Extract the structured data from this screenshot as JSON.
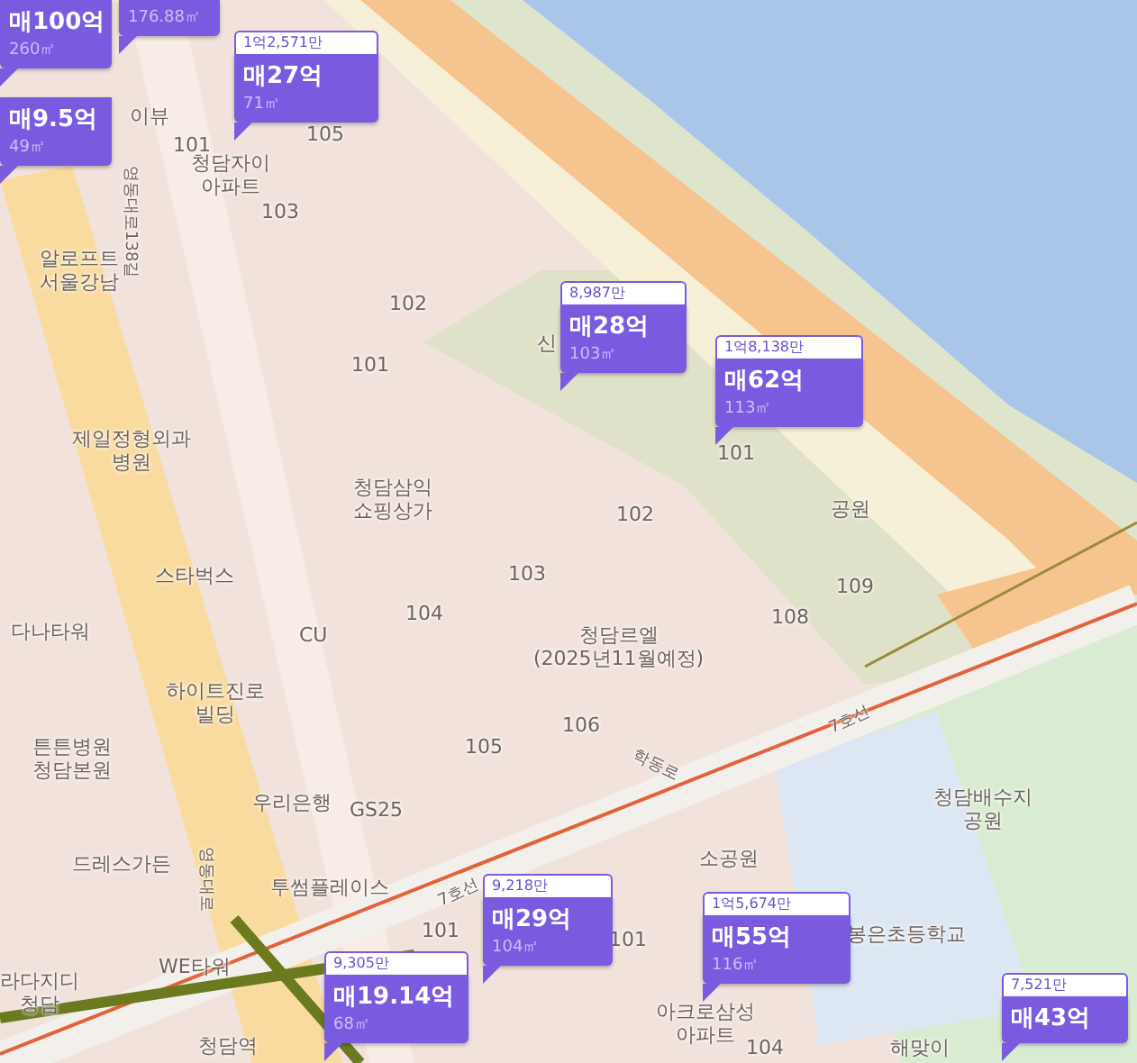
{
  "map": {
    "labels": [
      {
        "text": "이뷰"
      },
      {
        "text": "101"
      },
      {
        "text": "청담자이\n아파트"
      },
      {
        "text": "105"
      },
      {
        "text": "103"
      },
      {
        "text": "영동대로138길"
      },
      {
        "text": "알로프트\n서울강남"
      },
      {
        "text": "102"
      },
      {
        "text": "101"
      },
      {
        "text": "신"
      },
      {
        "text": "제일정형외과\n병원"
      },
      {
        "text": "청담삼익\n쇼핑상가"
      },
      {
        "text": "스타벅스"
      },
      {
        "text": "다나타워"
      },
      {
        "text": "CU"
      },
      {
        "text": "하이트진로\n빌딩"
      },
      {
        "text": "튼튼병원\n청담본원"
      },
      {
        "text": "우리은행"
      },
      {
        "text": "GS25"
      },
      {
        "text": "드레스가든"
      },
      {
        "text": "투썸플레이스"
      },
      {
        "text": "104"
      },
      {
        "text": "103"
      },
      {
        "text": "102"
      },
      {
        "text": "101"
      },
      {
        "text": "105"
      },
      {
        "text": "106"
      },
      {
        "text": "청담르엘\n(2025년11월예정)"
      },
      {
        "text": "108"
      },
      {
        "text": "공원"
      },
      {
        "text": "109"
      },
      {
        "text": "7호선"
      },
      {
        "text": "학동로"
      },
      {
        "text": "청담배수지\n공원"
      },
      {
        "text": "소공원"
      },
      {
        "text": "7호선"
      },
      {
        "text": "101"
      },
      {
        "text": "101"
      },
      {
        "text": "봉은초등학교"
      },
      {
        "text": "WE타워"
      },
      {
        "text": "라다지디\n청담"
      },
      {
        "text": "청담역"
      },
      {
        "text": "아크로삼성\n아파트"
      },
      {
        "text": "104"
      },
      {
        "text": "해맞이"
      },
      {
        "text": "영동대로"
      }
    ]
  },
  "markers": [
    {
      "price": "매100억",
      "area": "260㎡"
    },
    {
      "price": "매9.5억",
      "area": "49㎡"
    },
    {
      "area": "176.88㎡"
    },
    {
      "header": "1억2,571만",
      "price": "매27억",
      "area": "71㎡"
    },
    {
      "header": "8,987만",
      "price": "매28억",
      "area": "103㎡"
    },
    {
      "header": "1억8,138만",
      "price": "매62억",
      "area": "113㎡"
    },
    {
      "header": "9,218만",
      "price": "매29억",
      "area": "104㎡"
    },
    {
      "header": "9,305만",
      "price": "매19.14억",
      "area": "68㎡"
    },
    {
      "header": "1억5,674만",
      "price": "매55억",
      "area": "116㎡"
    },
    {
      "header": "7,521만",
      "price": "매43억"
    }
  ]
}
